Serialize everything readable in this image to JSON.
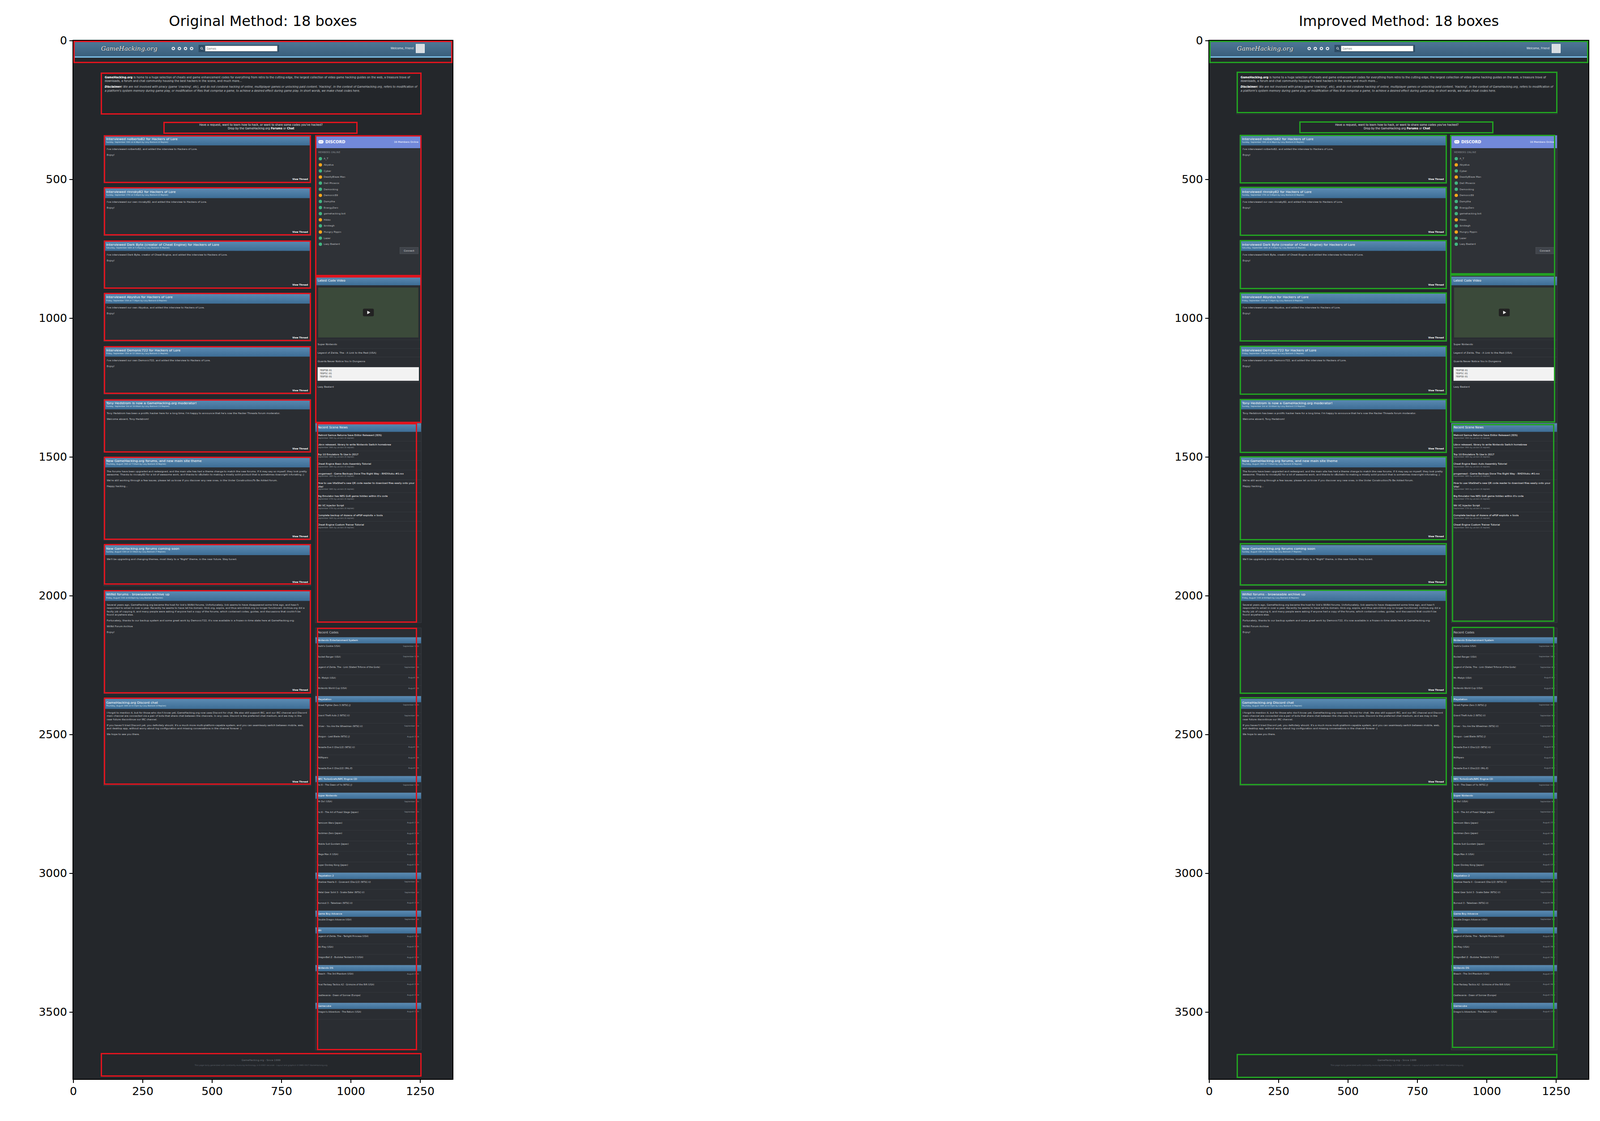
{
  "figure": {
    "panels": [
      {
        "title": "Original Method: 18 boxes",
        "box_color": "#e0141e",
        "boxes": [
          [
            0,
            0,
            1366,
            80
          ],
          [
            98,
            114,
            1254,
            266
          ],
          [
            324,
            292,
            1024,
            336
          ],
          [
            109,
            340,
            856,
            513
          ],
          [
            871,
            340,
            1254,
            849
          ],
          [
            109,
            528,
            856,
            701
          ],
          [
            109,
            720,
            856,
            893
          ],
          [
            871,
            849,
            1254,
            1377
          ],
          [
            109,
            908,
            856,
            1082
          ],
          [
            109,
            1100,
            856,
            1273
          ],
          [
            109,
            1292,
            856,
            1484
          ],
          [
            109,
            1499,
            856,
            1798
          ],
          [
            878,
            1377,
            1239,
            2097
          ],
          [
            109,
            1812,
            856,
            1960
          ],
          [
            109,
            1979,
            856,
            2351
          ],
          [
            109,
            2366,
            856,
            2680
          ],
          [
            878,
            2115,
            1239,
            3636
          ],
          [
            98,
            3647,
            1254,
            3732
          ]
        ]
      },
      {
        "title": "Improved Method: 18 boxes",
        "box_color": "#22a022",
        "boxes": [
          [
            0,
            0,
            1366,
            80
          ],
          [
            98,
            112,
            1254,
            262
          ],
          [
            324,
            290,
            1024,
            334
          ],
          [
            109,
            338,
            856,
            515
          ],
          [
            867,
            338,
            1246,
            842
          ],
          [
            109,
            526,
            856,
            703
          ],
          [
            109,
            718,
            856,
            895
          ],
          [
            867,
            842,
            1246,
            1375
          ],
          [
            109,
            906,
            856,
            1084
          ],
          [
            109,
            1098,
            856,
            1275
          ],
          [
            109,
            1290,
            856,
            1486
          ],
          [
            109,
            1497,
            856,
            1800
          ],
          [
            874,
            1380,
            1243,
            2094
          ],
          [
            109,
            1810,
            856,
            1962
          ],
          [
            109,
            1977,
            856,
            2353
          ],
          [
            109,
            2364,
            856,
            2682
          ],
          [
            874,
            2111,
            1243,
            3628
          ],
          [
            98,
            3650,
            1254,
            3736
          ]
        ]
      }
    ],
    "x_ticks": [
      "0",
      "250",
      "500",
      "750",
      "1000",
      "1250"
    ],
    "y_ticks": [
      "0",
      "500",
      "1000",
      "1500",
      "2000",
      "2500",
      "3000",
      "3500"
    ]
  },
  "page": {
    "nav": {
      "logo": "GameHacking.org",
      "search_placeholder": "Games",
      "user": "Welcome, Friend"
    },
    "intro": [
      {
        "lead": "GameHacking.org",
        "text": " is home to a huge selection of cheats and game enhancement codes for everything from retro to the cutting edge, the largest collection of video game hacking guides on the web, a treasure trove of downloads, a forum and chat community housing the best hackers in the scene, and much more..."
      },
      {
        "lead": "Disclaimer:",
        "text": " We are not involved with piracy (game 'cracking', etc), and do not condone hacking of online, multiplayer games or unlocking paid content. 'Hacking', in the context of GameHacking.org, refers to modification of a platform's system memory during game play, or modification of files that comprise a game, to achieve a desired effect during game play. In short words, we make cheat codes here."
      }
    ],
    "request": {
      "line1": "Have a request, want to learn how to hack, or want to share some codes you've hacked?",
      "line2": "Drop by the GameHacking.org ",
      "forums": "Forums",
      "or": " or ",
      "chat": "Chat"
    },
    "posts": [
      {
        "title": "Interviewed nolberto82 for Hackers of Lore",
        "meta": "Sunday, September 24th at 6:38pm by Lazy Bastard (0 Replies)",
        "body": [
          "I've interviewed nolberto82, and added the interview to Hackers of Lore.",
          "Enjoy!"
        ],
        "link": "View Thread"
      },
      {
        "title": "Interviewed rinnsky82 for Hackers of Lore",
        "meta": "Sunday, September 17th at 5:40pm by Lazy Bastard (0 Replies)",
        "body": [
          "I've interviewed our own rinnsky82, and added the interview to Hackers of Lore.",
          "Enjoy!"
        ],
        "link": "View Thread"
      },
      {
        "title": "Interviewed Dark Byte (creator of Cheat Engine) for Hackers of Lore",
        "meta": "Saturday, September 16th at 5:45pm by Lazy Bastard (0 Replies)",
        "body": [
          "I've interviewed Dark Byte, creator of Cheat Engine, and added the interview to Hackers of Lore.",
          "Enjoy!"
        ],
        "link": "View Thread"
      },
      {
        "title": "Interviewed Abystus for Hackers of Lore",
        "meta": "Friday, September 15th at 7:34pm by Lazy Bastard (0 Replies)",
        "body": [
          "I've interviewed our own Abystus, and added the interview to Hackers of Lore.",
          "Enjoy!"
        ],
        "link": "View Thread"
      },
      {
        "title": "Interviewed Demonic722 for Hackers of Lore",
        "meta": "Friday, September 15th at 12:16am by Lazy Bastard (1 Replies)",
        "body": [
          "I've interviewed our own Demonic722, and added the interview to Hackers of Lore.",
          "Enjoy!"
        ],
        "link": "View Thread"
      },
      {
        "title": "Tony Hedstrom is now a GameHacking.org moderator!",
        "meta": "Sunday, September 3rd at 10:46am by Lazy Bastard (13 Replies)",
        "body": [
          "Tony Hedstrom has been a prolific hacker here for a long time; I'm happy to announce that he's now the Hacker Threads forum moderator.",
          "Welcome aboard, Tony Hedstrom!"
        ],
        "link": "View Thread"
      },
      {
        "title": "New GameHacking.org forums, and new main site theme",
        "meta": "Thursday, August 24th at 7:54am by Lazy Bastard (9 Replies)",
        "body": [
          "The forums have been upgraded and redesigned, and the main site has had a theme change to match the new forums. If it may say so myself, they look pretty awesome. Thanks to rinnsky82 for a lot of awesome work, and thanks to vBulletin to making a mostly solid product that is sometimes downright infuriating ;)",
          "We're still working through a few issues; please let us know if you discover any new ones, in the Under Construction/To Be Added forum.",
          "Happy hacking..."
        ],
        "link": "View Thread"
      },
      {
        "title": "New GameHacking.org forums coming soon",
        "meta": "Sunday, August 13th at 12:59am by Lazy Bastard (7 Replies)",
        "body": [
          "We'll be upgrading and changing themes, most likely to a \"Night\" theme, in the near future. Stay tuned."
        ],
        "link": "View Thread"
      },
      {
        "title": "WiiNd forums - browseable archive up",
        "meta": "Friday, August 11th at 8:03pm by Lazy Bastard (6 Replies)",
        "body": [
          "Several years ago, GameHacking.org became the host for link's WiiNd forums. Unfortunately, link seems to have disappeared some time ago, and hasn't responded to email in over a year. Recently he seems to have let his domain, tlink.org, expire, and thus wiind.tlink.org no longer functioned. Archive.org did a faulty job of copying it, and many people were asking if anyone had a copy of the forums, which contained codes, guides, and discussions that couldn't be found anywhere else.",
          "Fortunately, thanks to our backup system and some great work by Demonic722, it's now available in a frozen-in-time state here at GameHacking.org:",
          "WiiNd Forum Archive",
          "Enjoy!"
        ],
        "link": "View Thread"
      },
      {
        "title": "GameHacking.org Discord chat",
        "meta": "Thursday, August 10th at 4:17pm by Lazy Bastard (4 Replies)",
        "body": [
          "I forgot to mention it, but for those who don't know yet, GameHacking.org now uses Discord for chat. We also still support IRC, and our IRC channel and Discord main channel are connected via a pair of bots that share chat between the channels. In any case, Discord is the preferred chat medium, and we may in the near future discontinue our IRC channel.",
          "If you haven't tried Discord yet, you definitely should. It's a much more multi-platform-capable system, and you can seamlessly switch between mobile, web, and desktop app, without worry about log configuration and missing conversations in the channel forever :)",
          "We hope to see you there."
        ],
        "link": "View Thread"
      }
    ],
    "discord": {
      "brand": "DISCORD",
      "online": "16 Members Online",
      "heading": "MEMBERS ONLINE",
      "members": [
        {
          "name": "A_T",
          "color": "#43b581"
        },
        {
          "name": "Abystus",
          "color": "#faa61a"
        },
        {
          "name": "Cyber",
          "color": "#43b581"
        },
        {
          "name": "DeadlyBlaze Man",
          "color": "#faa61a"
        },
        {
          "name": "Dell Phoenix",
          "color": "#43b581"
        },
        {
          "name": "Demonking",
          "color": "#43b581"
        },
        {
          "name": "Demonic89",
          "color": "#faa61a"
        },
        {
          "name": "Dsmytha",
          "color": "#43b581"
        },
        {
          "name": "EnergyZero",
          "color": "#43b581"
        },
        {
          "name": "gamehacking bot",
          "color": "#43b581"
        },
        {
          "name": "Hikko",
          "color": "#faa61a"
        },
        {
          "name": "ibrokegh",
          "color": "#43b581"
        },
        {
          "name": "Hungry Pippin",
          "color": "#faa61a"
        },
        {
          "name": "Lazer",
          "color": "#43b581"
        },
        {
          "name": "Lazy Bastard",
          "color": "#43b581"
        }
      ],
      "button": "Connect"
    },
    "video": {
      "title": "Latest Code Video",
      "system": "Super Nintendo",
      "game": "Legend of Zelda, The - A Link to the Past (USA)",
      "code": "Guards Never Notice You In Dungeons",
      "lines": [
        "7E0F5B:01",
        "7E0F5C:01",
        "7E0F5D:01"
      ],
      "author": "Lazy Bastard"
    },
    "news": {
      "title": "Recent Scene News",
      "items": [
        {
          "title": "Metroid Samus Returns Save Editor Released (3DS)",
          "meta": "September 19th by ukraini (0 replies)"
        },
        {
          "title": "Libnx released, library to write Nintendo Switch homebrew",
          "meta": "September 19th by ukraini (0 replies)"
        },
        {
          "title": "Top 10 Emulators To Use In 2017",
          "meta": "September 18th by ukraini (0 replies)"
        },
        {
          "title": "Cheat Engine Basic Auto Assembly Tutorial",
          "meta": "September 18th by ukraini (0 replies)"
        },
        {
          "title": "progamesd - Game Backups Done The Right Way - RHDYAoku #0.rxx",
          "meta": "September 18th by ukraini (0 replies)"
        },
        {
          "title": "How to use VitaShell's new QR code reader to download files easily onto your Vita!",
          "meta": "September 18th by ukraini (0 replies)"
        },
        {
          "title": "Big Emulator has NES GoR game hidden within it's code",
          "meta": "September 17th by ukraini (0 replies)"
        },
        {
          "title": "Wii VC Injector Script",
          "meta": "September 17th by ukraini (0 replies)"
        },
        {
          "title": "Complete backup of dozens of ePSP exploits + tools",
          "meta": "September 16th by ukraini (0 replies)"
        },
        {
          "title": "Cheat Engine Custom Trainer Tutorial",
          "meta": "September 16th by ukraini (0 replies)"
        }
      ]
    },
    "codes": {
      "title": "Recent Codes",
      "groups": [
        {
          "system": "Nintendo Entertainment System",
          "items": [
            {
              "game": "Yoshi's Cookie (USA)",
              "date": "September 19th"
            },
            {
              "game": "Rocket Ranger (USA)",
              "date": "September 18th"
            },
            {
              "game": "Legend of Zelda, The - Link (Stated Triforce of the Gods)",
              "date": "September 8th"
            },
            {
              "game": "Mr. Mistyk (USA)",
              "date": "August 8th"
            },
            {
              "game": "Nintendo World Cup (USA)",
              "date": "August 8th"
            }
          ]
        },
        {
          "system": "Playstation",
          "items": [
            {
              "game": "Street Fighter Zero 3 (NTSC-J)",
              "date": "September 19th"
            },
            {
              "game": "Grand Theft Auto 2 (NTSC-U)",
              "date": "September 9th"
            },
            {
              "game": "Driver - You Are the Wheelman (NTSC-U)",
              "date": "September 3rd"
            },
            {
              "game": "Shogun - Last Blade (NTSC-J)",
              "date": "August 23rd"
            },
            {
              "game": "Parasite Eve II (Disc1/2) (NTSC-U)",
              "date": "August 9th"
            },
            {
              "game": "PAPAparo",
              "date": "August 8th"
            },
            {
              "game": "Parasite Eve II (Disc2/2) (PAL-E)",
              "date": "August 8th"
            }
          ]
        },
        {
          "system": "NEC TurboGrafx/NPC Engine CD",
          "items": [
            {
              "game": "Ys III - The Dawn of Ys (NTSC-J)",
              "date": "September 11th"
            }
          ]
        },
        {
          "system": "Super Nintendo",
          "items": [
            {
              "game": "Mr Do! (USA)",
              "date": "September 9th"
            },
            {
              "game": "Ys III - The Art of Fossil Stage (Japan)",
              "date": "September 4th"
            },
            {
              "game": "Famicom Wars (Japan)",
              "date": "August 27th"
            },
            {
              "game": "Rockman Zero (Japan)",
              "date": "August 26th"
            },
            {
              "game": "Mobile Suit Gundam (Japan)",
              "date": "August 26th"
            },
            {
              "game": "Mega Man X (USA)",
              "date": "August 26th"
            },
            {
              "game": "Super Donkey Kong (Japan)",
              "date": "August 17th"
            }
          ]
        },
        {
          "system": "Playstation 2",
          "items": [
            {
              "game": "Shadow Hearts II - Covenant (Disc1/2) (NTSC-U)",
              "date": "September 6th"
            },
            {
              "game": "Metal Gear Solid 3 - Snake Eater (NTSC-U)",
              "date": "September 1st"
            },
            {
              "game": "Burnout 3 - Takedown (NTSC-U)",
              "date": "August 28th"
            }
          ]
        },
        {
          "system": "Game Boy Advance",
          "items": [
            {
              "game": "Double Dragon Advance (USA)",
              "date": "September 1st"
            }
          ]
        },
        {
          "system": "Wii",
          "items": [
            {
              "game": "Legend of Zelda, The - Twilight Princess (USA)",
              "date": "August 30th"
            },
            {
              "game": "Wii Play (USA)",
              "date": "August 28th"
            },
            {
              "game": "DragonBall Z - Budokai Tenkaichi 3 (USA)",
              "date": "August 26th"
            }
          ]
        },
        {
          "system": "Nintendo DS",
          "items": [
            {
              "game": "Bleach - The 3rd Phantom (USA)",
              "date": "August 27th"
            },
            {
              "game": "Final Fantasy Tactics A2 - Grimoire of the Rift (USA)",
              "date": "August 26th"
            },
            {
              "game": "Castlevania - Dawn of Sorrow (Europe)",
              "date": "August 23rd"
            }
          ]
        },
        {
          "system": "Gamecube",
          "items": [
            {
              "game": "Dragon's Adventure - The Return (USA)",
              "date": "August 17th"
            }
          ]
        }
      ]
    },
    "footer": {
      "line1": "GameHacking.org - Since 1999",
      "line2": "This page lazily generated with constantly evolving technology in 0.0302 seconds - Layout and graphics ©1995-2017 GameHacking.org"
    }
  }
}
